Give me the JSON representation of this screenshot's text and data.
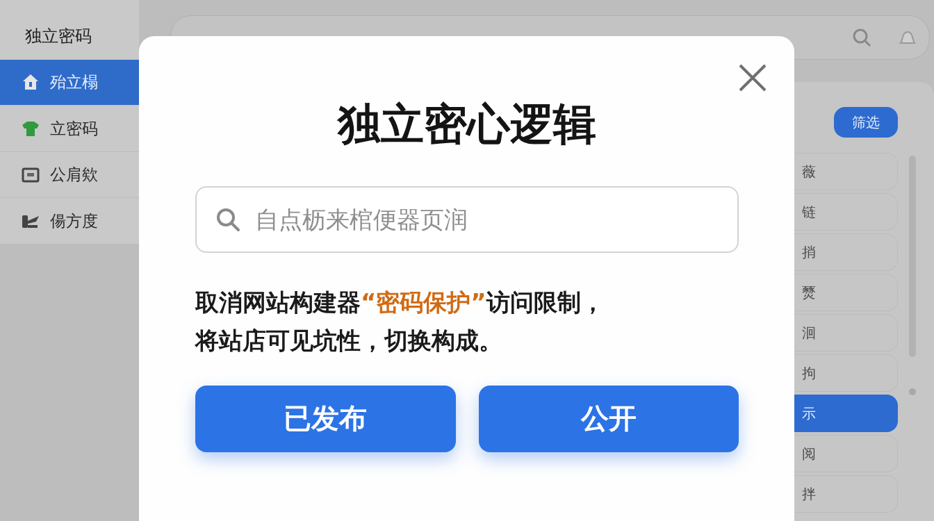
{
  "sidebar": {
    "title": "独立密码",
    "items": [
      {
        "label": "殆立榻",
        "kind": "house",
        "selected": true
      },
      {
        "label": "立密码",
        "kind": "shirt",
        "selected": false
      },
      {
        "label": "公肩欸",
        "kind": "card",
        "selected": false
      },
      {
        "label": "偒方度",
        "kind": "tools",
        "selected": false
      }
    ]
  },
  "right_panel": {
    "filter_button": "筛选",
    "items": [
      {
        "label": "薇",
        "selected": false
      },
      {
        "label": "链",
        "selected": false
      },
      {
        "label": "捎",
        "selected": false
      },
      {
        "label": "燹",
        "selected": false
      },
      {
        "label": "洄",
        "selected": false
      },
      {
        "label": "拘",
        "selected": false
      },
      {
        "label": "示",
        "selected": true
      },
      {
        "label": "阅",
        "selected": false
      },
      {
        "label": "拌",
        "selected": false
      }
    ]
  },
  "dialog": {
    "title": "独立密心逻辑",
    "search": {
      "placeholder": "自点枥来棺便器页润"
    },
    "message_lines": [
      [
        {
          "text": "取消网站构建器",
          "highlight": false
        },
        {
          "text": "“密码保护”",
          "highlight": true
        },
        {
          "text": "访问限制，",
          "highlight": false
        }
      ],
      [
        {
          "text": "将站店可见坑性，切换构成。",
          "highlight": false
        }
      ]
    ],
    "buttons": [
      "已发布",
      "公开"
    ]
  }
}
